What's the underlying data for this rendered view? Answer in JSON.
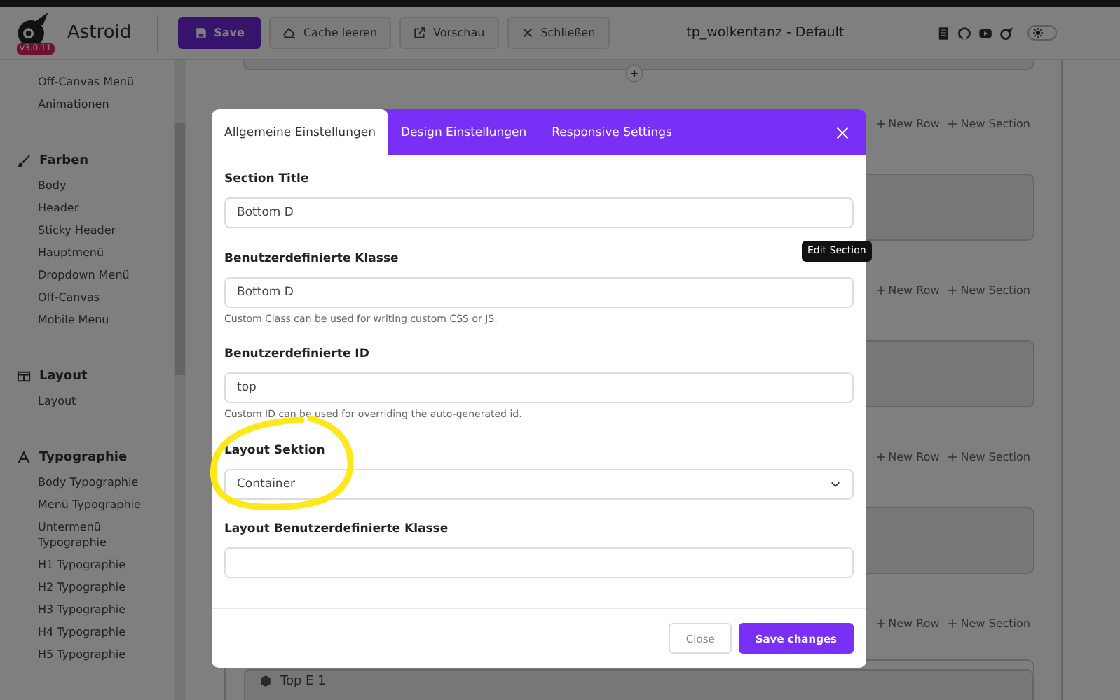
{
  "header": {
    "logo_text": "Astroid",
    "version": "v3.0.11",
    "buttons": [
      {
        "label": "Save",
        "kind": "primary"
      },
      {
        "label": "Cache leeren",
        "kind": "default"
      },
      {
        "label": "Vorschau",
        "kind": "default"
      },
      {
        "label": "Schließen",
        "kind": "default"
      }
    ],
    "title": "tp_wolkentanz - Default",
    "dark_mode": {
      "on": false
    }
  },
  "sidebar": {
    "groups": [
      {
        "items": [
          "Off-Canvas Menü",
          "Animationen"
        ]
      },
      {
        "title": "Farben",
        "items": [
          "Body",
          "Header",
          "Sticky Header",
          "Hauptmenü",
          "Dropdown Menü",
          "Off-Canvas",
          "Mobile Menu"
        ]
      },
      {
        "title": "Layout",
        "items": [
          "Layout"
        ]
      },
      {
        "title": "Typographie",
        "items": [
          "Body Typographie",
          "Menü Typographie",
          "Untermenü Typographie",
          "H1 Typographie",
          "H2 Typographie",
          "H3 Typographie",
          "H4 Typographie",
          "H5 Typographie"
        ]
      }
    ]
  },
  "canvas": {
    "section_toolbars": [
      {
        "new_row": "New Row",
        "new_section": "New Section"
      },
      {
        "new_row": "New Row",
        "new_section": "New Section"
      },
      {
        "new_row": "New Row",
        "new_section": "New Section"
      },
      {
        "new_row": "New Row",
        "new_section": "New Section"
      }
    ],
    "last_card_title": "Top E 1",
    "tooltip": "Edit Section"
  },
  "modal": {
    "tabs": [
      {
        "label": "Allgemeine Einstellungen",
        "selected": true
      },
      {
        "label": "Design Einstellungen",
        "selected": false
      },
      {
        "label": "Responsive Settings",
        "selected": false
      }
    ],
    "fields": [
      {
        "kind": "text",
        "label": "Section Title",
        "value": "Bottom D"
      },
      {
        "kind": "text",
        "label": "Benutzerdefinierte Klasse",
        "value": "Bottom D",
        "help": "Custom Class can be used for writing custom CSS or JS."
      },
      {
        "kind": "text",
        "label": "Benutzerdefinierte ID",
        "value": "top",
        "help": "Custom ID can be used for overriding the auto-generated id."
      },
      {
        "kind": "select",
        "label": "Layout Sektion",
        "value": "Container"
      },
      {
        "kind": "text",
        "label": "Layout Benutzerdefinierte Klasse"
      }
    ],
    "buttons": [
      {
        "label": "Close",
        "kind": "default"
      },
      {
        "label": "Save changes",
        "kind": "primary"
      }
    ]
  }
}
